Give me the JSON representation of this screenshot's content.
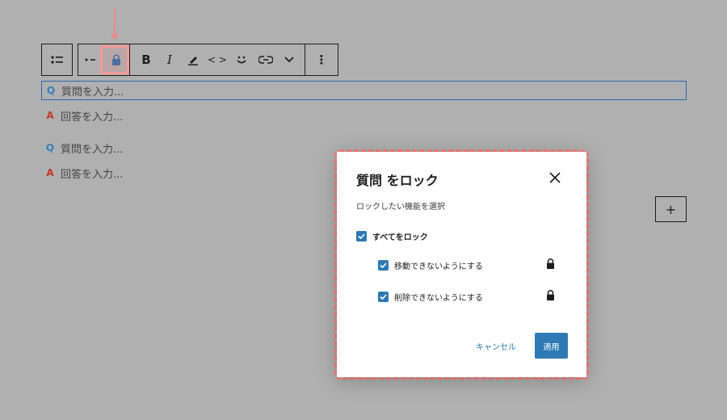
{
  "toolbar": {
    "bold_label": "B",
    "italic_label": "I",
    "code_label": "< >",
    "more_label": "⋮"
  },
  "faq": [
    {
      "mark": "Q",
      "placeholder": "質問を入力..."
    },
    {
      "mark": "A",
      "placeholder": "回答を入力..."
    },
    {
      "mark": "Q",
      "placeholder": "質問を入力..."
    },
    {
      "mark": "A",
      "placeholder": "回答を入力..."
    }
  ],
  "add_label": "+",
  "modal": {
    "title": "質問 をロック",
    "description": "ロックしたい機能を選択",
    "lock_all": "すべてをロック",
    "lock_move": "移動できないようにする",
    "lock_remove": "削除できないようにする",
    "cancel": "キャンセル",
    "apply": "適用",
    "checked": {
      "lock_all": true,
      "lock_move": true,
      "lock_remove": true
    }
  },
  "colors": {
    "accent": "#2f7ab5",
    "highlight": "#ff7d7d",
    "question": "#3a7fbf",
    "answer": "#c0392b"
  }
}
